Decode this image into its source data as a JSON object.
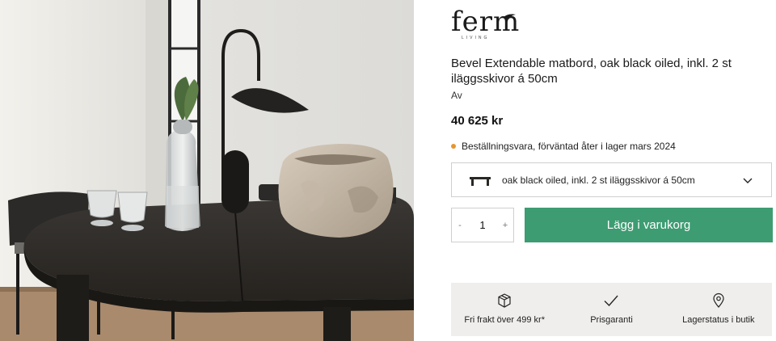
{
  "brand": {
    "logo_text": "ferm",
    "logo_subtext": "LIVING"
  },
  "product": {
    "title": "Bevel Extendable matbord, oak black oiled, inkl. 2 st iläggsskivor á 50cm",
    "byline": "Av",
    "price": "40 625 kr",
    "stock_status": "Beställningsvara, förväntad åter i lager mars 2024",
    "stock_status_color": "#e7962d",
    "photo_alt": "Bevel Extendable matbord, oak black oiled"
  },
  "variant": {
    "selected": "oak black oiled, inkl. 2 st iläggsskivor á 50cm",
    "thumb_icon": "table-thumbnail-icon",
    "chevron_icon": "chevron-down-icon"
  },
  "quantity": {
    "minus": "-",
    "value": "1",
    "plus": "+"
  },
  "cart": {
    "add_label": "Lägg i varukorg",
    "button_color": "#3d9c72"
  },
  "usps": [
    {
      "icon": "box-icon",
      "label": "Fri frakt över 499 kr*"
    },
    {
      "icon": "checkmark-icon",
      "label": "Prisgaranti"
    },
    {
      "icon": "location-pin-icon",
      "label": "Lagerstatus i butik"
    }
  ]
}
